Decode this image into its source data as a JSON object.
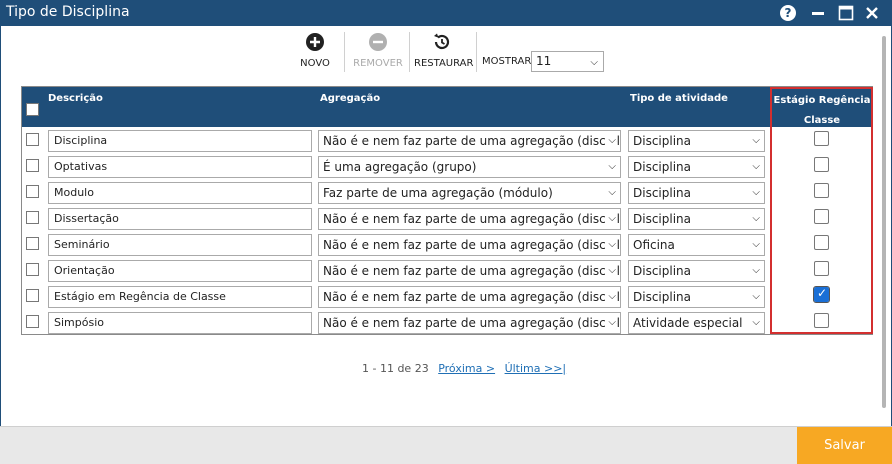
{
  "window": {
    "title": "Tipo de Disciplina",
    "help_label": "?"
  },
  "toolbar": {
    "novo_label": "NOVO",
    "remover_label": "REMOVER",
    "restaurar_label": "RESTAURAR",
    "mostrar_label": "MOSTRAR:",
    "mostrar_value": "11"
  },
  "table": {
    "headers": {
      "descricao": "Descrição",
      "agregacao": "Agregação",
      "tipo": "Tipo de atividade",
      "regencia": "Estágio Regência Classe"
    },
    "rows": [
      {
        "descricao": "Disciplina",
        "agregacao": "Não é e nem faz parte de uma agregação (disciplina comum)",
        "tipo": "Disciplina",
        "regencia": false
      },
      {
        "descricao": "Optativas",
        "agregacao": "É uma agregação (grupo)",
        "tipo": "Disciplina",
        "regencia": false
      },
      {
        "descricao": "Modulo",
        "agregacao": "Faz parte de uma agregação (módulo)",
        "tipo": "Disciplina",
        "regencia": false
      },
      {
        "descricao": "Dissertação",
        "agregacao": "Não é e nem faz parte de uma agregação (disciplina comum)",
        "tipo": "Disciplina",
        "regencia": false
      },
      {
        "descricao": "Seminário",
        "agregacao": "Não é e nem faz parte de uma agregação (disciplina comum)",
        "tipo": "Oficina",
        "regencia": false
      },
      {
        "descricao": "Orientação",
        "agregacao": "Não é e nem faz parte de uma agregação (disciplina comum)",
        "tipo": "Disciplina",
        "regencia": false
      },
      {
        "descricao": "Estágio em Regência de Classe",
        "agregacao": "Não é e nem faz parte de uma agregação (disciplina comum)",
        "tipo": "Disciplina",
        "regencia": true
      },
      {
        "descricao": "Simpósio",
        "agregacao": "Não é e nem faz parte de uma agregação (disciplina comum)",
        "tipo": "Atividade especial",
        "regencia": false
      }
    ]
  },
  "pager": {
    "count": "1 - 11 de 23",
    "next_label": "Próxima >",
    "last_label": "Última >>|"
  },
  "footer": {
    "save_label": "Salvar"
  },
  "colors": {
    "header_bg": "#1f4e79",
    "save_bg": "#f7a823",
    "highlight": "#d32f2f",
    "checked": "#1a6fd6"
  }
}
